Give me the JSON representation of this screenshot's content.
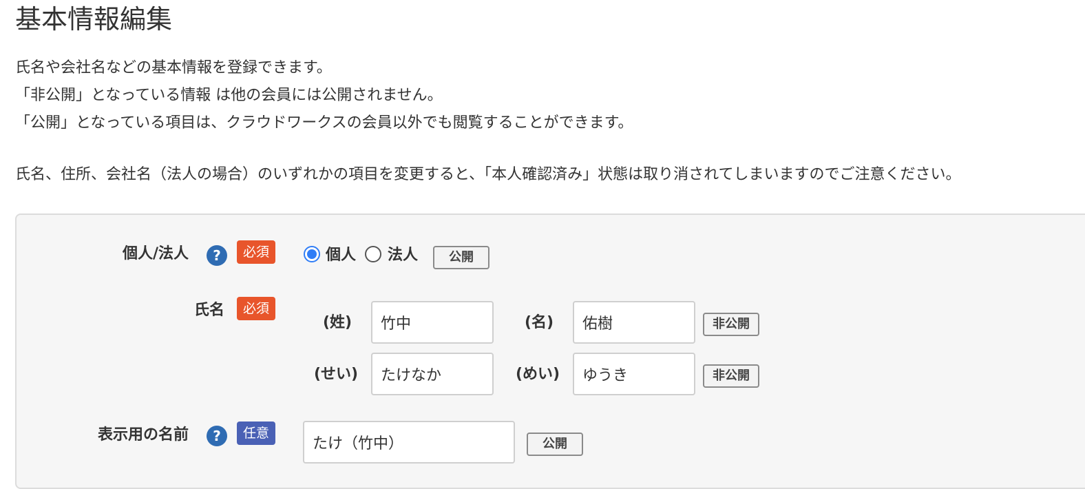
{
  "page": {
    "title": "基本情報編集",
    "description": [
      "氏名や会社名などの基本情報を登録できます。",
      "「非公開」となっている情報 は他の会員には公開されません。",
      "「公開」となっている項目は、クラウドワークスの会員以外でも閲覧することができます。"
    ],
    "notice": "氏名、住所、会社名（法人の場合）のいずれかの項目を変更すると、「本人確認済み」状態は取り消されてしまいますのでご注意ください。"
  },
  "form": {
    "entity_type": {
      "label": "個人/法人",
      "help_icon": "?",
      "badge": "必須",
      "options": [
        {
          "label": "個人",
          "selected": true
        },
        {
          "label": "法人",
          "selected": false
        }
      ],
      "visibility": "公開"
    },
    "name": {
      "label": "氏名",
      "badge": "必須",
      "last_name_label": "(姓)",
      "last_name_value": "竹中",
      "first_name_label": "(名)",
      "first_name_value": "佑樹",
      "name_visibility": "非公開",
      "last_kana_label": "(せい)",
      "last_kana_value": "たけなか",
      "first_kana_label": "(めい)",
      "first_kana_value": "ゆうき",
      "kana_visibility": "非公開"
    },
    "display_name": {
      "label": "表示用の名前",
      "help_icon": "?",
      "badge": "任意",
      "value": "たけ（竹中）",
      "visibility": "公開"
    }
  },
  "colors": {
    "required_badge": "#e8552b",
    "optional_badge": "#4a61b5",
    "help_icon": "#2f6cb3",
    "radio_selected": "#2f7df6",
    "panel_background": "#f6f6f6"
  },
  "icons": {
    "help": "question-circle-icon"
  }
}
